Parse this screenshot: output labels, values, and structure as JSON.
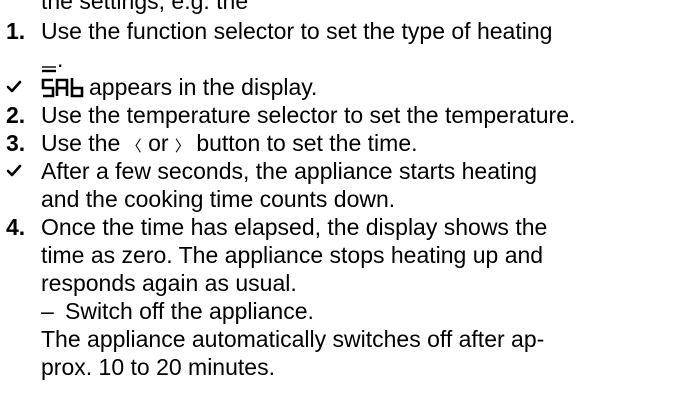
{
  "cut_line": "the settings, e.g. the",
  "steps": [
    {
      "marker": "1.",
      "text": "Use the function selector to set the type of heating"
    },
    {
      "suffix": "."
    },
    {
      "text": "appears in the display.",
      "icon_name": "sabbath-display-icon"
    },
    {
      "marker": "2.",
      "text": "Use the temperature selector to set the temperature."
    },
    {
      "marker": "3.",
      "pre": "Use the",
      "btn_left": "〈",
      "mid": "or",
      "btn_right": "〉",
      "post": "button to set the time."
    },
    {
      "text": "After a few seconds, the appliance starts heating"
    },
    {
      "text": "and the cooking time counts down."
    },
    {
      "marker": "4.",
      "text": "Once the time has elapsed, the display shows the"
    },
    {
      "text": "time as zero. The appliance stops heating up and"
    },
    {
      "text": "responds again as usual."
    },
    {
      "dash": "–",
      "text": "Switch off the appliance."
    },
    {
      "text": "The appliance automatically switches off after ap-"
    },
    {
      "text": "prox. 10 to 20 minutes."
    }
  ],
  "icons": {
    "heating": "bottom-heat-icon",
    "result": "check-icon",
    "display": "sabbath-display-icon"
  }
}
